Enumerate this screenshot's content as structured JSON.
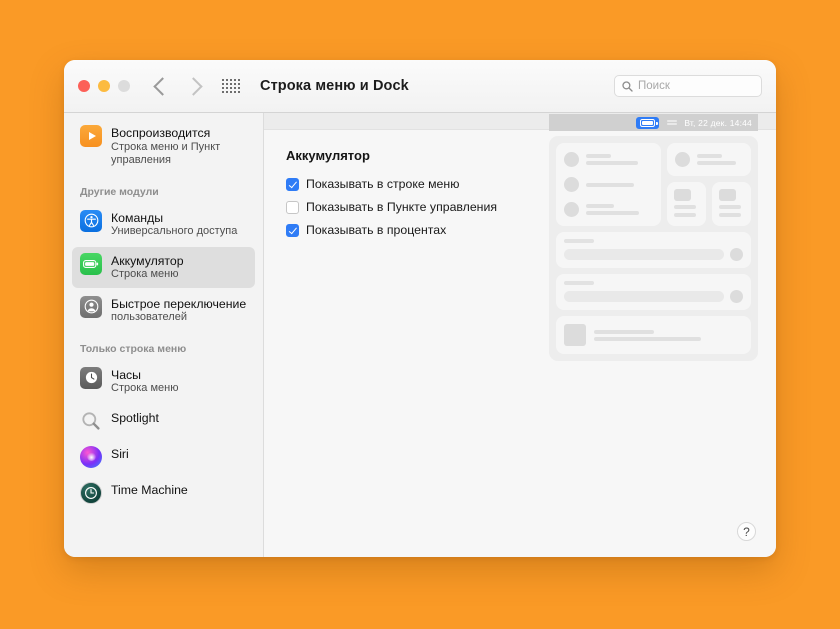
{
  "window": {
    "title": "Строка меню и Dock",
    "traffic_lights": [
      "close",
      "minimize",
      "zoom"
    ],
    "nav": {
      "back": "back-chevron",
      "forward": "forward-chevron"
    },
    "grid_button": "show-all-preferences",
    "search": {
      "placeholder": "Поиск",
      "value": ""
    }
  },
  "sidebar": {
    "top_items": [
      {
        "icon": "play-icon",
        "title": "Воспроизводится",
        "subtitle": "Строка меню и Пункт управления",
        "selected": false
      }
    ],
    "groups": [
      {
        "header": "Другие модули",
        "items": [
          {
            "icon": "accessibility-icon",
            "title": "Команды",
            "subtitle": "Универсального доступа",
            "selected": false
          },
          {
            "icon": "battery-icon",
            "title": "Аккумулятор",
            "subtitle": "Строка меню",
            "selected": true
          },
          {
            "icon": "user-switch-icon",
            "title": "Быстрое переключение",
            "subtitle": "пользователей",
            "selected": false
          }
        ]
      },
      {
        "header": "Только строка меню",
        "items": [
          {
            "icon": "clock-icon",
            "title": "Часы",
            "subtitle": "Строка меню",
            "selected": false
          },
          {
            "icon": "spotlight-icon",
            "title": "Spotlight",
            "subtitle": "",
            "selected": false
          },
          {
            "icon": "siri-icon",
            "title": "Siri",
            "subtitle": "",
            "selected": false
          },
          {
            "icon": "time-machine-icon",
            "title": "Time Machine",
            "subtitle": "",
            "selected": false
          }
        ]
      }
    ]
  },
  "main": {
    "section_title": "Аккумулятор",
    "checkboxes": [
      {
        "label": "Показывать в строке меню",
        "checked": true
      },
      {
        "label": "Показывать в Пункте управления",
        "checked": false
      },
      {
        "label": "Показывать в процентах",
        "checked": true
      }
    ],
    "help_label": "?"
  },
  "preview": {
    "menubar": {
      "battery_icon": "battery-icon",
      "battery_highlight_color": "#2f7cf6",
      "control_center_icon": "control-center-icon",
      "datetime": "Вт, 22 дек.  14:44"
    }
  },
  "colors": {
    "desktop_background": "#fa9a26",
    "accent": "#2f7cf6",
    "selected_row": "#dedede",
    "battery_icon_green": "#34c84a"
  }
}
